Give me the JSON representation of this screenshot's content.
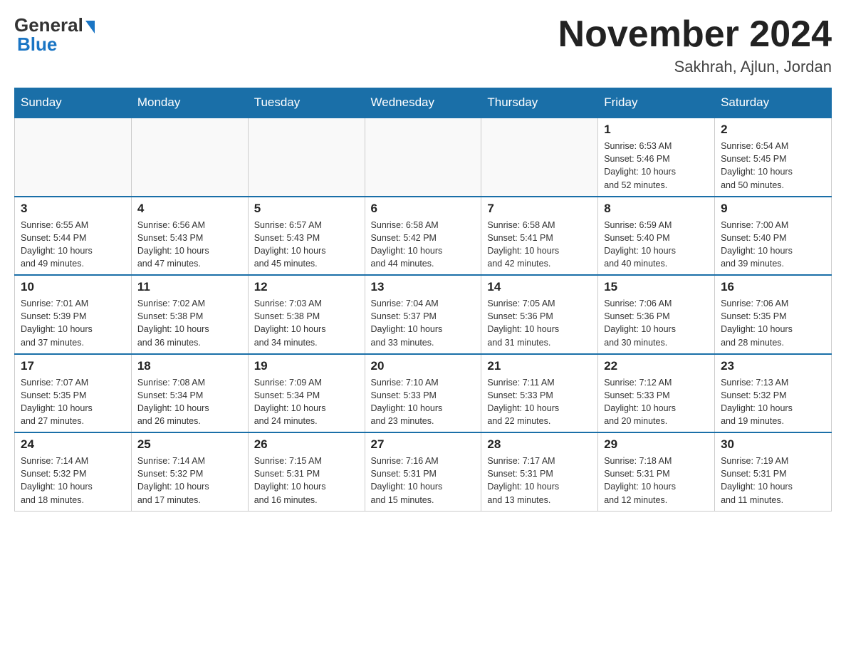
{
  "header": {
    "logo_line1": "General",
    "logo_line2": "Blue",
    "month_title": "November 2024",
    "location": "Sakhrah, Ajlun, Jordan"
  },
  "weekdays": [
    "Sunday",
    "Monday",
    "Tuesday",
    "Wednesday",
    "Thursday",
    "Friday",
    "Saturday"
  ],
  "weeks": [
    [
      {
        "day": "",
        "info": ""
      },
      {
        "day": "",
        "info": ""
      },
      {
        "day": "",
        "info": ""
      },
      {
        "day": "",
        "info": ""
      },
      {
        "day": "",
        "info": ""
      },
      {
        "day": "1",
        "info": "Sunrise: 6:53 AM\nSunset: 5:46 PM\nDaylight: 10 hours\nand 52 minutes."
      },
      {
        "day": "2",
        "info": "Sunrise: 6:54 AM\nSunset: 5:45 PM\nDaylight: 10 hours\nand 50 minutes."
      }
    ],
    [
      {
        "day": "3",
        "info": "Sunrise: 6:55 AM\nSunset: 5:44 PM\nDaylight: 10 hours\nand 49 minutes."
      },
      {
        "day": "4",
        "info": "Sunrise: 6:56 AM\nSunset: 5:43 PM\nDaylight: 10 hours\nand 47 minutes."
      },
      {
        "day": "5",
        "info": "Sunrise: 6:57 AM\nSunset: 5:43 PM\nDaylight: 10 hours\nand 45 minutes."
      },
      {
        "day": "6",
        "info": "Sunrise: 6:58 AM\nSunset: 5:42 PM\nDaylight: 10 hours\nand 44 minutes."
      },
      {
        "day": "7",
        "info": "Sunrise: 6:58 AM\nSunset: 5:41 PM\nDaylight: 10 hours\nand 42 minutes."
      },
      {
        "day": "8",
        "info": "Sunrise: 6:59 AM\nSunset: 5:40 PM\nDaylight: 10 hours\nand 40 minutes."
      },
      {
        "day": "9",
        "info": "Sunrise: 7:00 AM\nSunset: 5:40 PM\nDaylight: 10 hours\nand 39 minutes."
      }
    ],
    [
      {
        "day": "10",
        "info": "Sunrise: 7:01 AM\nSunset: 5:39 PM\nDaylight: 10 hours\nand 37 minutes."
      },
      {
        "day": "11",
        "info": "Sunrise: 7:02 AM\nSunset: 5:38 PM\nDaylight: 10 hours\nand 36 minutes."
      },
      {
        "day": "12",
        "info": "Sunrise: 7:03 AM\nSunset: 5:38 PM\nDaylight: 10 hours\nand 34 minutes."
      },
      {
        "day": "13",
        "info": "Sunrise: 7:04 AM\nSunset: 5:37 PM\nDaylight: 10 hours\nand 33 minutes."
      },
      {
        "day": "14",
        "info": "Sunrise: 7:05 AM\nSunset: 5:36 PM\nDaylight: 10 hours\nand 31 minutes."
      },
      {
        "day": "15",
        "info": "Sunrise: 7:06 AM\nSunset: 5:36 PM\nDaylight: 10 hours\nand 30 minutes."
      },
      {
        "day": "16",
        "info": "Sunrise: 7:06 AM\nSunset: 5:35 PM\nDaylight: 10 hours\nand 28 minutes."
      }
    ],
    [
      {
        "day": "17",
        "info": "Sunrise: 7:07 AM\nSunset: 5:35 PM\nDaylight: 10 hours\nand 27 minutes."
      },
      {
        "day": "18",
        "info": "Sunrise: 7:08 AM\nSunset: 5:34 PM\nDaylight: 10 hours\nand 26 minutes."
      },
      {
        "day": "19",
        "info": "Sunrise: 7:09 AM\nSunset: 5:34 PM\nDaylight: 10 hours\nand 24 minutes."
      },
      {
        "day": "20",
        "info": "Sunrise: 7:10 AM\nSunset: 5:33 PM\nDaylight: 10 hours\nand 23 minutes."
      },
      {
        "day": "21",
        "info": "Sunrise: 7:11 AM\nSunset: 5:33 PM\nDaylight: 10 hours\nand 22 minutes."
      },
      {
        "day": "22",
        "info": "Sunrise: 7:12 AM\nSunset: 5:33 PM\nDaylight: 10 hours\nand 20 minutes."
      },
      {
        "day": "23",
        "info": "Sunrise: 7:13 AM\nSunset: 5:32 PM\nDaylight: 10 hours\nand 19 minutes."
      }
    ],
    [
      {
        "day": "24",
        "info": "Sunrise: 7:14 AM\nSunset: 5:32 PM\nDaylight: 10 hours\nand 18 minutes."
      },
      {
        "day": "25",
        "info": "Sunrise: 7:14 AM\nSunset: 5:32 PM\nDaylight: 10 hours\nand 17 minutes."
      },
      {
        "day": "26",
        "info": "Sunrise: 7:15 AM\nSunset: 5:31 PM\nDaylight: 10 hours\nand 16 minutes."
      },
      {
        "day": "27",
        "info": "Sunrise: 7:16 AM\nSunset: 5:31 PM\nDaylight: 10 hours\nand 15 minutes."
      },
      {
        "day": "28",
        "info": "Sunrise: 7:17 AM\nSunset: 5:31 PM\nDaylight: 10 hours\nand 13 minutes."
      },
      {
        "day": "29",
        "info": "Sunrise: 7:18 AM\nSunset: 5:31 PM\nDaylight: 10 hours\nand 12 minutes."
      },
      {
        "day": "30",
        "info": "Sunrise: 7:19 AM\nSunset: 5:31 PM\nDaylight: 10 hours\nand 11 minutes."
      }
    ]
  ]
}
